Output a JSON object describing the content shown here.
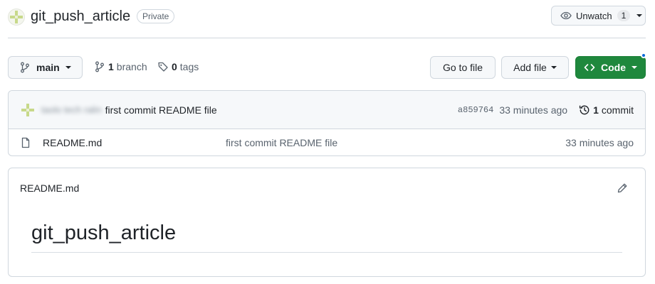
{
  "repo": {
    "name": "git_push_article",
    "visibility": "Private"
  },
  "watch": {
    "label": "Unwatch",
    "count": "1"
  },
  "branch_selector": {
    "label": "main"
  },
  "branches": {
    "count": "1",
    "label": "branch"
  },
  "tags": {
    "count": "0",
    "label": "tags"
  },
  "actions": {
    "go_to_file": "Go to file",
    "add_file": "Add file",
    "code": "Code"
  },
  "latest_commit": {
    "author": "taolo tech ralin",
    "message": "first commit README file",
    "hash": "a859764",
    "time": "33 minutes ago",
    "commits_count": "1",
    "commits_label": "commit"
  },
  "files": [
    {
      "name": "README.md",
      "message": "first commit README file",
      "time": "33 minutes ago",
      "icon": "file-icon"
    }
  ],
  "readme": {
    "filename": "README.md",
    "heading": "git_push_article"
  },
  "colors": {
    "code_button": "#1f883d",
    "accent_dot": "#0969da",
    "border": "#d0d7de"
  }
}
